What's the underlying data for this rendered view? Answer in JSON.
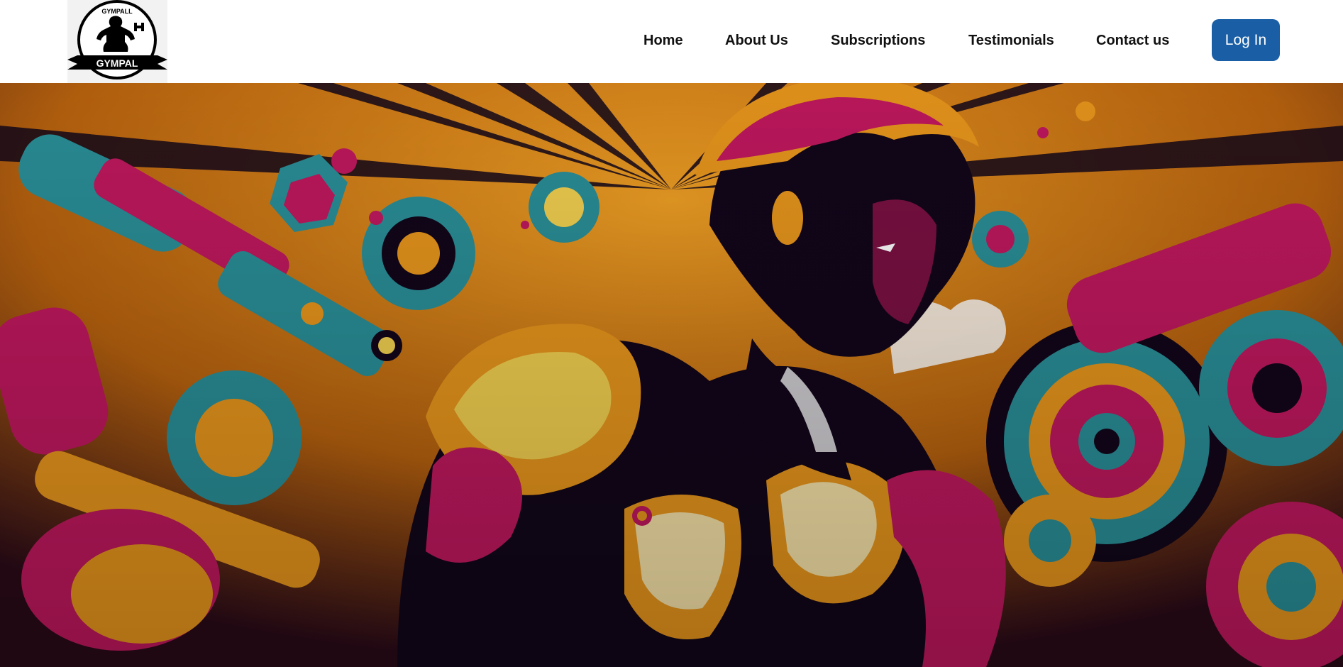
{
  "brand": {
    "logo_top_text": "GYMPALL",
    "logo_banner_text": "GYMPAL"
  },
  "nav": {
    "items": [
      {
        "label": "Home"
      },
      {
        "label": "About Us"
      },
      {
        "label": "Subscriptions"
      },
      {
        "label": "Testimonials"
      },
      {
        "label": "Contact us"
      }
    ],
    "login_label": "Log In"
  },
  "colors": {
    "login_button": "#1a5fa5",
    "hero_orange": "#e8961c",
    "hero_magenta": "#c0185e",
    "hero_teal": "#2a8f98",
    "hero_dark": "#12061a"
  },
  "hero": {
    "image": "muscular-man-with-dumbbells-pop-art-illustration"
  }
}
